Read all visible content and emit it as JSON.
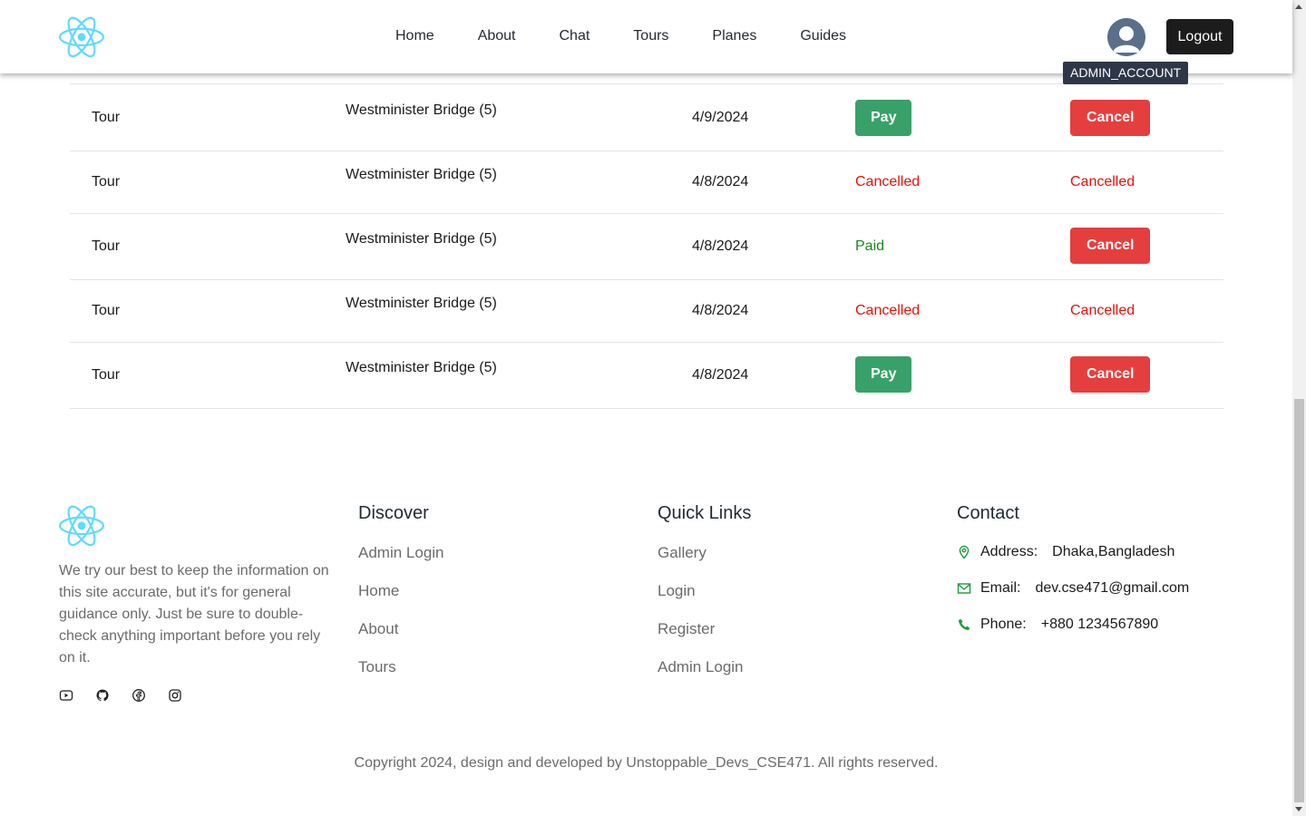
{
  "header": {
    "nav": [
      "Home",
      "About",
      "Chat",
      "Tours",
      "Planes",
      "Guides"
    ],
    "avatar_tooltip": "ADMIN_ACCOUNT",
    "logout_label": "Logout"
  },
  "bookings": {
    "rows": [
      {
        "type": "Tour",
        "place": "Westminister Bridge (5)",
        "date": "4/9/2024",
        "status": "Pay",
        "status_kind": "button",
        "action": "Cancel",
        "action_kind": "button"
      },
      {
        "type": "Tour",
        "place": "Westminister Bridge (5)",
        "date": "4/8/2024",
        "status": "Cancelled",
        "status_kind": "cancelled",
        "action": "Cancelled",
        "action_kind": "cancelled"
      },
      {
        "type": "Tour",
        "place": "Westminister Bridge (5)",
        "date": "4/8/2024",
        "status": "Paid",
        "status_kind": "paid",
        "action": "Cancel",
        "action_kind": "button"
      },
      {
        "type": "Tour",
        "place": "Westminister Bridge (5)",
        "date": "4/8/2024",
        "status": "Cancelled",
        "status_kind": "cancelled",
        "action": "Cancelled",
        "action_kind": "cancelled"
      },
      {
        "type": "Tour",
        "place": "Westminister Bridge (5)",
        "date": "4/8/2024",
        "status": "Pay",
        "status_kind": "button",
        "action": "Cancel",
        "action_kind": "button"
      }
    ]
  },
  "footer": {
    "about_text": "We try our best to keep the information on this site accurate, but it's for general guidance only. Just be sure to double-check anything important before you rely on it.",
    "socials": [
      "youtube-icon",
      "github-icon",
      "facebook-icon",
      "instagram-icon"
    ],
    "discover": {
      "title": "Discover",
      "links": [
        "Admin Login",
        "Home",
        "About",
        "Tours"
      ]
    },
    "quick_links": {
      "title": "Quick Links",
      "links": [
        "Gallery",
        "Login",
        "Register",
        "Admin Login"
      ]
    },
    "contact": {
      "title": "Contact",
      "address_label": "Address:",
      "address": "Dhaka,Bangladesh",
      "email_label": "Email:",
      "email": "dev.cse471@gmail.com",
      "phone_label": "Phone:",
      "phone": "+880 1234567890"
    },
    "copyright": "Copyright 2024, design and developed by Unstoppable_Devs_CSE471. All rights reserved."
  },
  "colors": {
    "pay": "#38a169",
    "cancel": "#e53e3e",
    "cancelled_text": "#e3120b",
    "paid_text": "#138a19",
    "accent_icon": "#1a9e3c",
    "logo": "#61dafb"
  }
}
